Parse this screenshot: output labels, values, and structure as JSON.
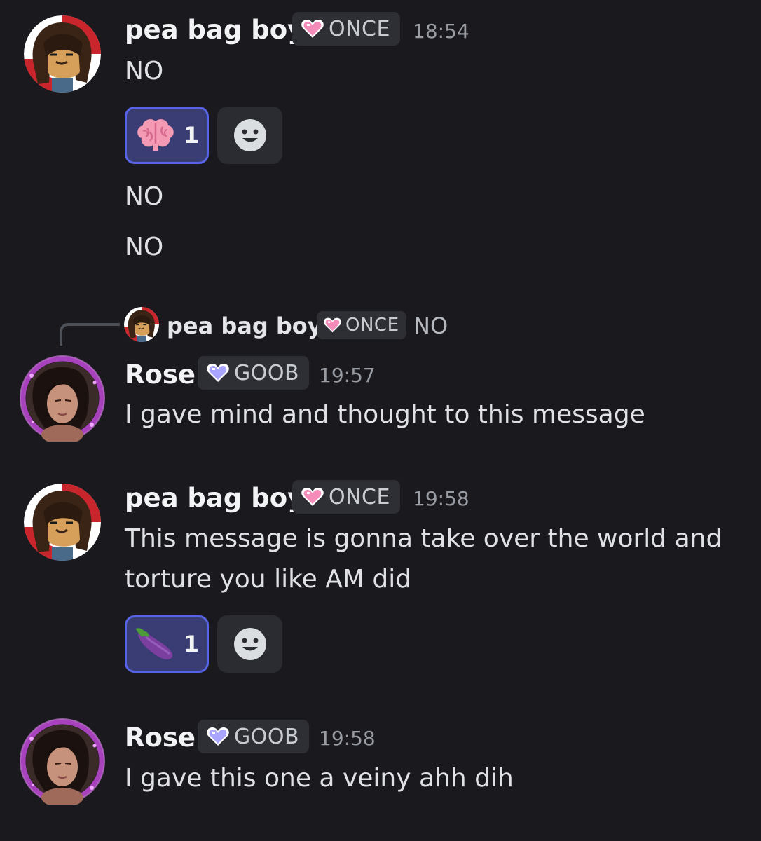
{
  "colors": {
    "background": "#1a1a1e",
    "reaction_bg": "#3a3d73",
    "reaction_border": "#5864e8",
    "tag_bg": "#2e2f35",
    "once_heart": "#f48bb8",
    "goob_heart": "#a9a5ff"
  },
  "messages": [
    {
      "author": "pea bag boy",
      "tag": "ONCE",
      "tag_icon": "pink-heart-icon",
      "time": "18:54",
      "lines": [
        "NO"
      ],
      "reaction": {
        "emoji": "brain-emoji",
        "count": "1"
      },
      "followups": [
        "NO",
        "NO"
      ]
    },
    {
      "reply_to": {
        "author": "pea bag boy",
        "tag": "ONCE",
        "preview": "NO"
      },
      "author": "Rose",
      "tag": "GOOB",
      "tag_icon": "lavender-heart-icon",
      "time": "19:57",
      "lines": [
        "I gave mind and thought to this message"
      ]
    },
    {
      "author": "pea bag boy",
      "tag": "ONCE",
      "tag_icon": "pink-heart-icon",
      "time": "19:58",
      "lines": [
        "This message is gonna take over the world and",
        "torture you like AM did"
      ],
      "reaction": {
        "emoji": "eggplant-emoji",
        "count": "1"
      }
    },
    {
      "author": "Rose",
      "tag": "GOOB",
      "tag_icon": "lavender-heart-icon",
      "time": "19:58",
      "lines": [
        "I gave this one a veiny ahh dih"
      ]
    }
  ]
}
